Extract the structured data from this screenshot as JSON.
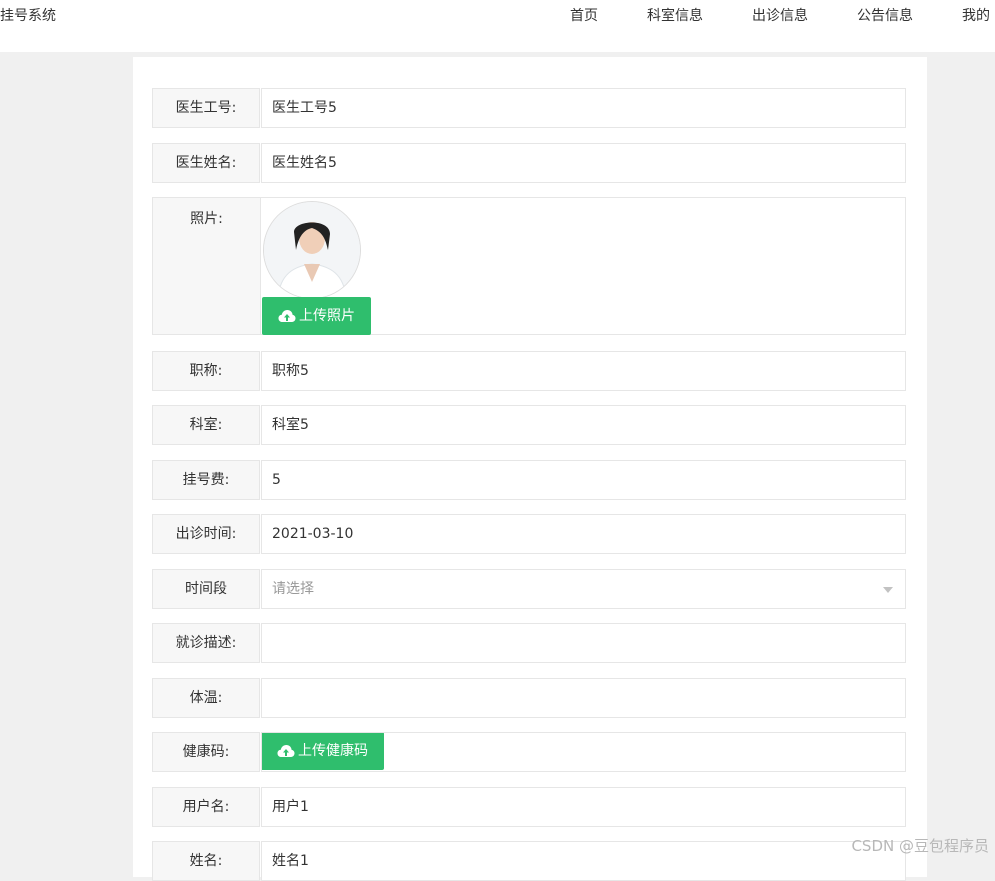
{
  "header": {
    "brand": "挂号系统",
    "nav": [
      "首页",
      "科室信息",
      "出诊信息",
      "公告信息",
      "我的"
    ]
  },
  "form": {
    "doctor_id": {
      "label": "医生工号:",
      "value": "医生工号5"
    },
    "doctor_name": {
      "label": "医生姓名:",
      "value": "医生姓名5"
    },
    "photo": {
      "label": "照片:",
      "upload_label": "上传照片"
    },
    "title": {
      "label": "职称:",
      "value": "职称5"
    },
    "department": {
      "label": "科室:",
      "value": "科室5"
    },
    "fee": {
      "label": "挂号费:",
      "value": "5"
    },
    "visit_time": {
      "label": "出诊时间:",
      "value": "2021-03-10"
    },
    "time_slot": {
      "label": "时间段",
      "placeholder": "请选择"
    },
    "description": {
      "label": "就诊描述:",
      "value": ""
    },
    "temperature": {
      "label": "体温:",
      "value": ""
    },
    "health_code": {
      "label": "健康码:",
      "upload_label": "上传健康码"
    },
    "username": {
      "label": "用户名:",
      "value": "用户1"
    },
    "fullname": {
      "label": "姓名:",
      "value": "姓名1"
    }
  },
  "watermark": "CSDN @豆包程序员",
  "colors": {
    "accent_green": "#2fbe6d",
    "page_bg": "#f0f0f0",
    "label_bg": "#f7f7f7"
  },
  "icons": {
    "upload": "cloud-upload-icon",
    "dropdown": "chevron-down-icon"
  }
}
